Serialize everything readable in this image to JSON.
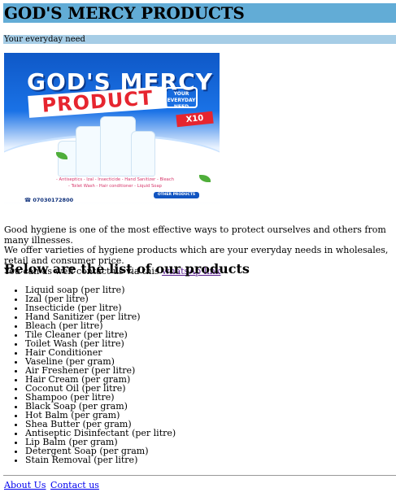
{
  "header": {
    "title": "GOD'S MERCY PRODUCTS",
    "tagline": "Your everyday need"
  },
  "hero_image": {
    "title": "GOD'S MERCY",
    "product_word": "PRODUCT",
    "badge": "YOUR EVERYDAY NEED",
    "multiplier": "X10",
    "items_line1": "- Antiseptics - Izal - Insecticide - Hand Sanitizer - Bleach",
    "items_line2": "- Toilet Wash - Hair conditioner - Liquid Soap",
    "phone": "07030172800",
    "other_products": "OTHER PRODUCTS"
  },
  "intro": {
    "line1": "Good hygiene is one of the most effective ways to protect ourselves and others from many illnesses.",
    "line2": "We offer varieties of hygiene products which are your everyday needs in wholesales, retail and consumer price.",
    "line3_prefix": "You can as well contact us via this ",
    "whatsapp_link": "whatsAp link"
  },
  "products": {
    "heading": "Below are the list of our products",
    "items": [
      "Liquid soap (per litre)",
      "Izal (per litre)",
      "Insecticide (per litre)",
      "Hand Sanitizer (per litre)",
      "Bleach (per litre)",
      "Tile Cleaner (per litre)",
      "Toilet Wash (per litre)",
      "Hair Conditioner",
      "Vaseline (per gram)",
      "Air Freshener (per litre)",
      "Hair Cream (per gram)",
      "Coconut Oil (per litre)",
      "Shampoo (per litre)",
      "Black Soap (per gram)",
      "Hot Balm (per gram)",
      "Shea Butter (per gram)",
      "Antiseptic Disinfectant (per litre)",
      "Lip Balm (per gram)",
      "Detergent Soap (per gram)",
      "Stain Removal (per litre)"
    ]
  },
  "footer": {
    "about": "About Us",
    "contact": "Contact us"
  },
  "colors": {
    "header_bg": "#62acd6",
    "tagline_bg": "#a6cde6",
    "link_visited": "#551a8b",
    "link": "#0000ee"
  }
}
